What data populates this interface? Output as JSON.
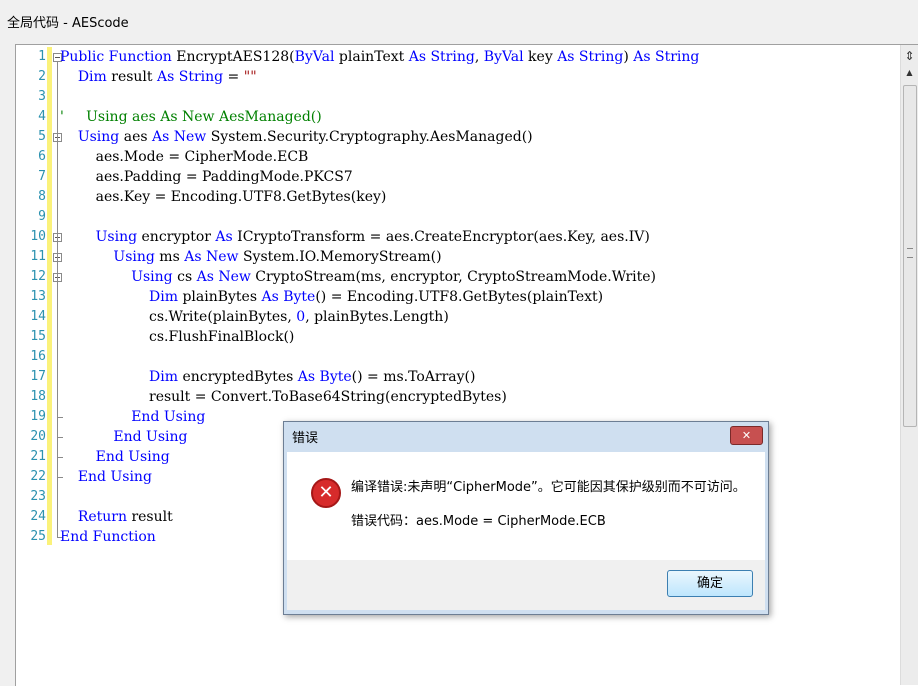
{
  "window": {
    "title": "全局代码 - AEScode"
  },
  "editor": {
    "line_numbers": [
      "1",
      "2",
      "3",
      "4",
      "5",
      "6",
      "7",
      "8",
      "9",
      "10",
      "11",
      "12",
      "13",
      "14",
      "15",
      "16",
      "17",
      "18",
      "19",
      "20",
      "21",
      "22",
      "23",
      "24",
      "25"
    ],
    "lines": [
      [
        [
          "kw",
          "Public Function "
        ],
        [
          "",
          "EncryptAES128("
        ],
        [
          "kw",
          "ByVal"
        ],
        [
          "",
          " plainText "
        ],
        [
          "kw",
          "As String"
        ],
        [
          "",
          ", "
        ],
        [
          "kw",
          "ByVal"
        ],
        [
          "",
          " key "
        ],
        [
          "kw",
          "As String"
        ],
        [
          "",
          ") "
        ],
        [
          "kw",
          "As String"
        ]
      ],
      [
        [
          "",
          "    "
        ],
        [
          "kw",
          "Dim"
        ],
        [
          "",
          " result "
        ],
        [
          "kw",
          "As String"
        ],
        [
          "",
          " = "
        ],
        [
          "st",
          "\"\""
        ]
      ],
      [
        [
          "",
          ""
        ]
      ],
      [
        [
          "cm",
          "'     Using aes As New AesManaged()"
        ]
      ],
      [
        [
          "",
          "    "
        ],
        [
          "kw",
          "Using"
        ],
        [
          "",
          " aes "
        ],
        [
          "kw",
          "As New"
        ],
        [
          "",
          " System.Security.Cryptography.AesManaged()"
        ]
      ],
      [
        [
          "",
          "        aes.Mode = CipherMode.ECB"
        ]
      ],
      [
        [
          "",
          "        aes.Padding = PaddingMode.PKCS7"
        ]
      ],
      [
        [
          "",
          "        aes.Key = Encoding.UTF8.GetBytes(key)"
        ]
      ],
      [
        [
          "",
          ""
        ]
      ],
      [
        [
          "",
          "        "
        ],
        [
          "kw",
          "Using"
        ],
        [
          "",
          " encryptor "
        ],
        [
          "kw",
          "As"
        ],
        [
          "",
          " ICryptoTransform = aes.CreateEncryptor(aes.Key, aes.IV)"
        ]
      ],
      [
        [
          "",
          "            "
        ],
        [
          "kw",
          "Using"
        ],
        [
          "",
          " ms "
        ],
        [
          "kw",
          "As New"
        ],
        [
          "",
          " System.IO.MemoryStream()"
        ]
      ],
      [
        [
          "",
          "                "
        ],
        [
          "kw",
          "Using"
        ],
        [
          "",
          " cs "
        ],
        [
          "kw",
          "As New"
        ],
        [
          "",
          " CryptoStream(ms, encryptor, CryptoStreamMode.Write)"
        ]
      ],
      [
        [
          "",
          "                    "
        ],
        [
          "kw",
          "Dim"
        ],
        [
          "",
          " plainBytes "
        ],
        [
          "kw",
          "As Byte"
        ],
        [
          "",
          "() = Encoding.UTF8.GetBytes(plainText)"
        ]
      ],
      [
        [
          "",
          "                    cs.Write(plainBytes, "
        ],
        [
          "kw",
          "0"
        ],
        [
          "",
          ", plainBytes.Length)"
        ]
      ],
      [
        [
          "",
          "                    cs.FlushFinalBlock()"
        ]
      ],
      [
        [
          "",
          ""
        ]
      ],
      [
        [
          "",
          "                    "
        ],
        [
          "kw",
          "Dim"
        ],
        [
          "",
          " encryptedBytes "
        ],
        [
          "kw",
          "As Byte"
        ],
        [
          "",
          "() = ms.ToArray()"
        ]
      ],
      [
        [
          "",
          "                    result = Convert.ToBase64String(encryptedBytes)"
        ]
      ],
      [
        [
          "",
          "                "
        ],
        [
          "kw",
          "End Using"
        ]
      ],
      [
        [
          "",
          "            "
        ],
        [
          "kw",
          "End Using"
        ]
      ],
      [
        [
          "",
          "        "
        ],
        [
          "kw",
          "End Using"
        ]
      ],
      [
        [
          "",
          "    "
        ],
        [
          "kw",
          "End Using"
        ]
      ],
      [
        [
          "",
          ""
        ]
      ],
      [
        [
          "",
          "    "
        ],
        [
          "kw",
          "Return"
        ],
        [
          "",
          " result"
        ]
      ],
      [
        [
          "kw",
          "End Function"
        ]
      ]
    ],
    "fold_markers": [
      1,
      5,
      10,
      11,
      12
    ]
  },
  "dialog": {
    "title": "错误",
    "close_glyph": "✕",
    "icon": "error-icon",
    "message": "编译错误:未声明“CipherMode”。它可能因其保护级别而不可访问。",
    "detail": "错误代码：aes.Mode = CipherMode.ECB",
    "ok_label": "确定"
  },
  "colors": {
    "keyword": "#0000ff",
    "comment": "#008000",
    "string": "#a31515",
    "line_number": "#2b91af",
    "changed_bar": "#fbf27a"
  }
}
